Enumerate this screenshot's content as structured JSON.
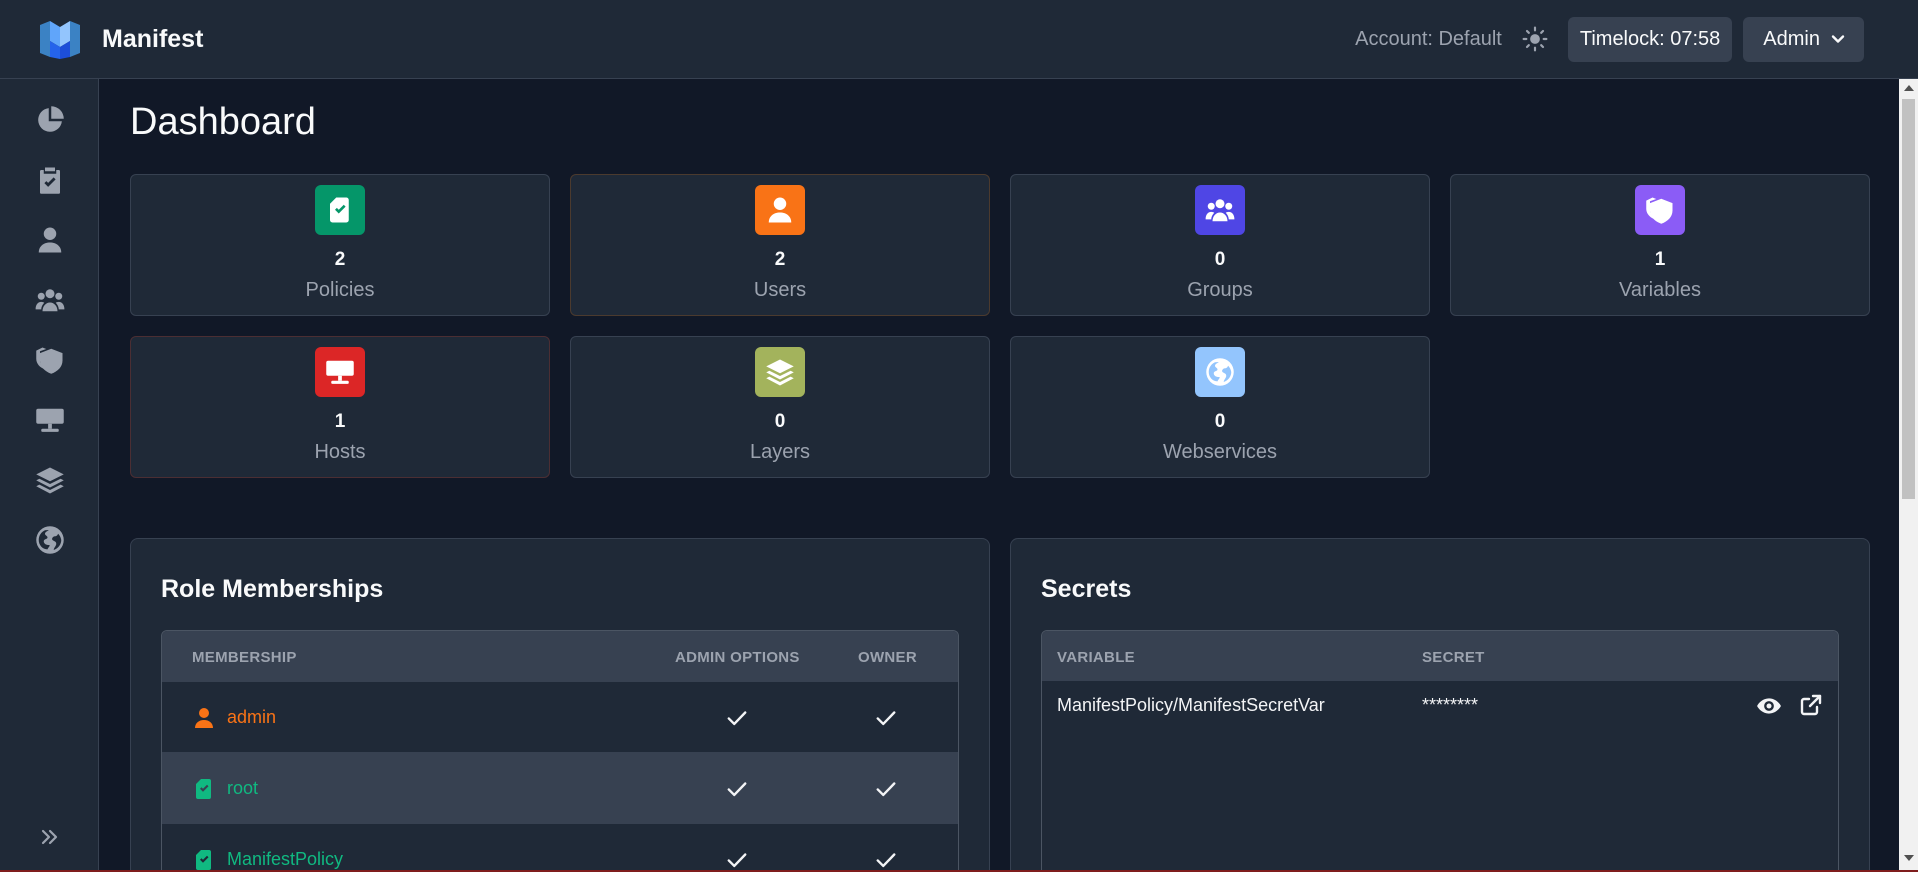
{
  "header": {
    "app_name": "Manifest",
    "account": "Account: Default",
    "timelock": "Timelock: 07:58",
    "user_menu": "Admin"
  },
  "page": {
    "title": "Dashboard"
  },
  "stats": [
    {
      "count": "2",
      "label": "Policies",
      "color": "#059669",
      "icon": "policy-icon"
    },
    {
      "count": "2",
      "label": "Users",
      "color": "#f97316",
      "icon": "user-icon"
    },
    {
      "count": "0",
      "label": "Groups",
      "color": "#4f46e5",
      "icon": "group-icon"
    },
    {
      "count": "1",
      "label": "Variables",
      "color": "#8b5cf6",
      "icon": "variable-icon"
    },
    {
      "count": "1",
      "label": "Hosts",
      "color": "#dc2626",
      "icon": "host-icon"
    },
    {
      "count": "0",
      "label": "Layers",
      "color": "#a3b35c",
      "icon": "layer-icon"
    },
    {
      "count": "0",
      "label": "Webservices",
      "color": "#93c5fd",
      "icon": "globe-icon"
    }
  ],
  "role_memberships": {
    "title": "Role Memberships",
    "columns": [
      "MEMBERSHIP",
      "ADMIN OPTIONS",
      "OWNER"
    ],
    "rows": [
      {
        "name": "admin",
        "kind": "user",
        "color": "#f97316"
      },
      {
        "name": "root",
        "kind": "policy",
        "color": "#10b981"
      },
      {
        "name": "ManifestPolicy",
        "kind": "policy",
        "color": "#10b981"
      }
    ]
  },
  "secrets": {
    "title": "Secrets",
    "columns": [
      "VARIABLE",
      "SECRET"
    ],
    "rows": [
      {
        "variable": "ManifestPolicy/ManifestSecretVar",
        "secret": "********"
      }
    ]
  },
  "sidebar": {
    "items": [
      "dashboard-icon",
      "policies-icon",
      "users-icon",
      "groups-icon",
      "variables-icon",
      "hosts-icon",
      "layers-icon",
      "webservices-icon"
    ]
  }
}
